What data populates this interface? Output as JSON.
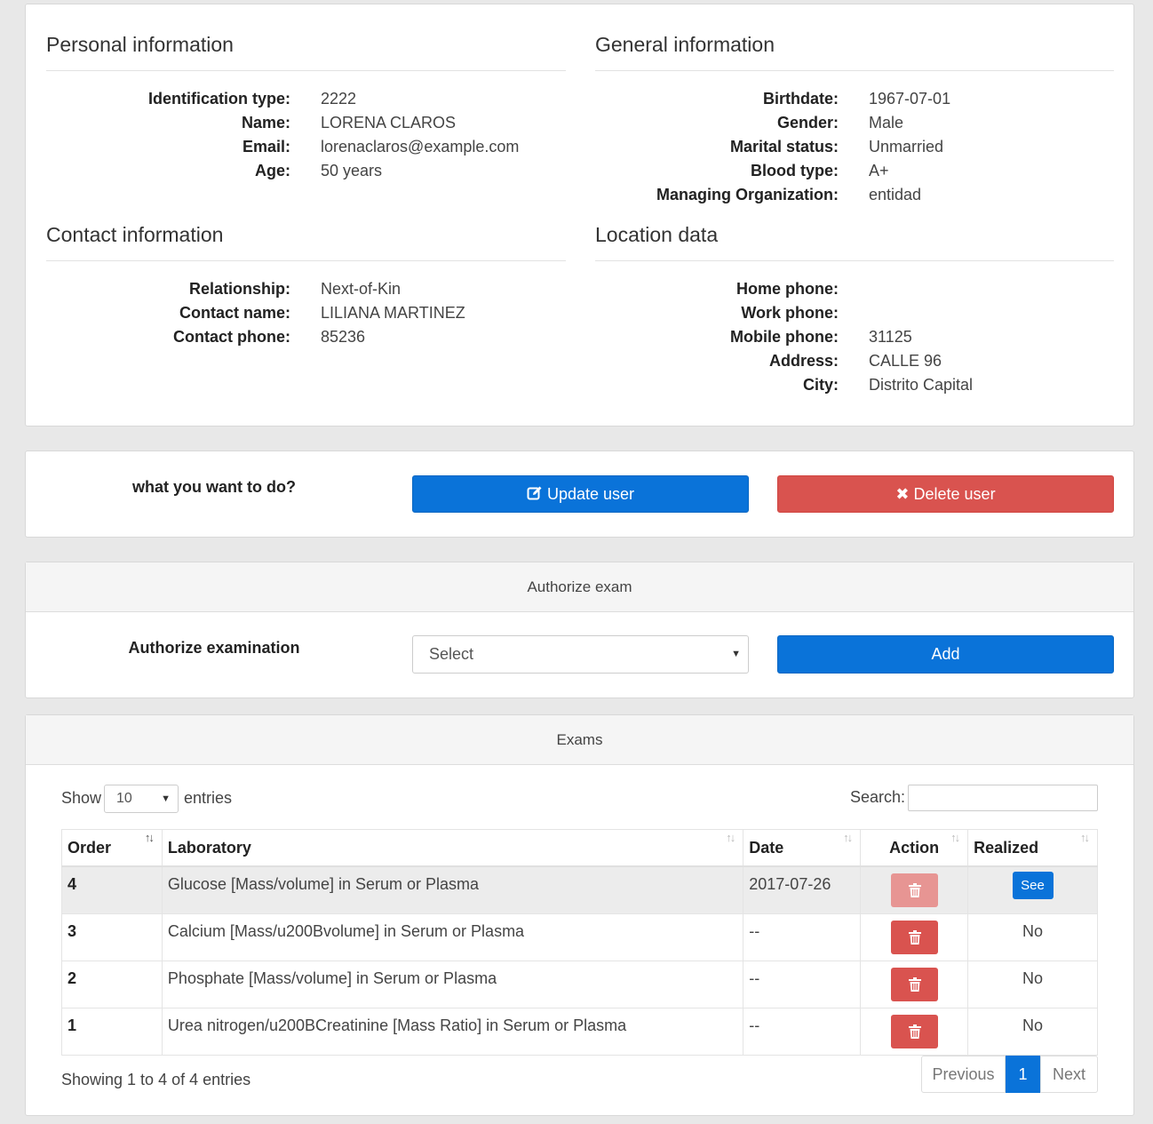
{
  "personal": {
    "title": "Personal information",
    "rows": [
      {
        "label": "Identification type:",
        "value": "2222"
      },
      {
        "label": "Name:",
        "value": "LORENA CLAROS"
      },
      {
        "label": "Email:",
        "value": "lorenaclaros@example.com"
      },
      {
        "label": "Age:",
        "value": "50 years"
      }
    ]
  },
  "general": {
    "title": "General information",
    "rows": [
      {
        "label": "Birthdate:",
        "value": "1967-07-01"
      },
      {
        "label": "Gender:",
        "value": "Male"
      },
      {
        "label": "Marital status:",
        "value": "Unmarried"
      },
      {
        "label": "Blood type:",
        "value": "A+"
      },
      {
        "label": "Managing Organization:",
        "value": "entidad"
      }
    ]
  },
  "contact": {
    "title": "Contact information",
    "rows": [
      {
        "label": "Relationship:",
        "value": "Next-of-Kin"
      },
      {
        "label": "Contact name:",
        "value": "LILIANA MARTINEZ"
      },
      {
        "label": "Contact phone:",
        "value": "85236"
      }
    ]
  },
  "location": {
    "title": "Location data",
    "rows": [
      {
        "label": "Home phone:",
        "value": ""
      },
      {
        "label": "Work phone:",
        "value": ""
      },
      {
        "label": "Mobile phone:",
        "value": "31125"
      },
      {
        "label": "Address:",
        "value": "CALLE 96"
      },
      {
        "label": "City:",
        "value": "Distrito Capital"
      }
    ]
  },
  "actions": {
    "prompt": "what you want to do?",
    "update_label": "Update user",
    "delete_label": "Delete user"
  },
  "authorize": {
    "heading": "Authorize exam",
    "label": "Authorize examination",
    "select_value": "Select",
    "add_label": "Add"
  },
  "exams": {
    "heading": "Exams",
    "show_label": "Show",
    "page_size": "10",
    "entries_label": "entries",
    "search_label": "Search:",
    "columns": [
      "Order",
      "Laboratory",
      "Date",
      "Action",
      "Realized"
    ],
    "rows": [
      {
        "order": "4",
        "laboratory": "Glucose [Mass/volume] in Serum or Plasma",
        "date": "2017-07-26",
        "realized": "See"
      },
      {
        "order": "3",
        "laboratory": "Calcium [Mass/u200Bvolume] in Serum or Plasma",
        "date": "--",
        "realized": "No"
      },
      {
        "order": "2",
        "laboratory": "Phosphate [Mass/volume] in Serum or Plasma",
        "date": "--",
        "realized": "No"
      },
      {
        "order": "1",
        "laboratory": "Urea nitrogen/u200BCreatinine [Mass Ratio] in Serum or Plasma",
        "date": "--",
        "realized": "No"
      }
    ],
    "info": "Showing 1 to 4 of 4 entries",
    "pager": {
      "previous": "Previous",
      "current": "1",
      "next": "Next"
    }
  },
  "colors": {
    "primary": "#0a73d9",
    "danger": "#d9534f"
  }
}
